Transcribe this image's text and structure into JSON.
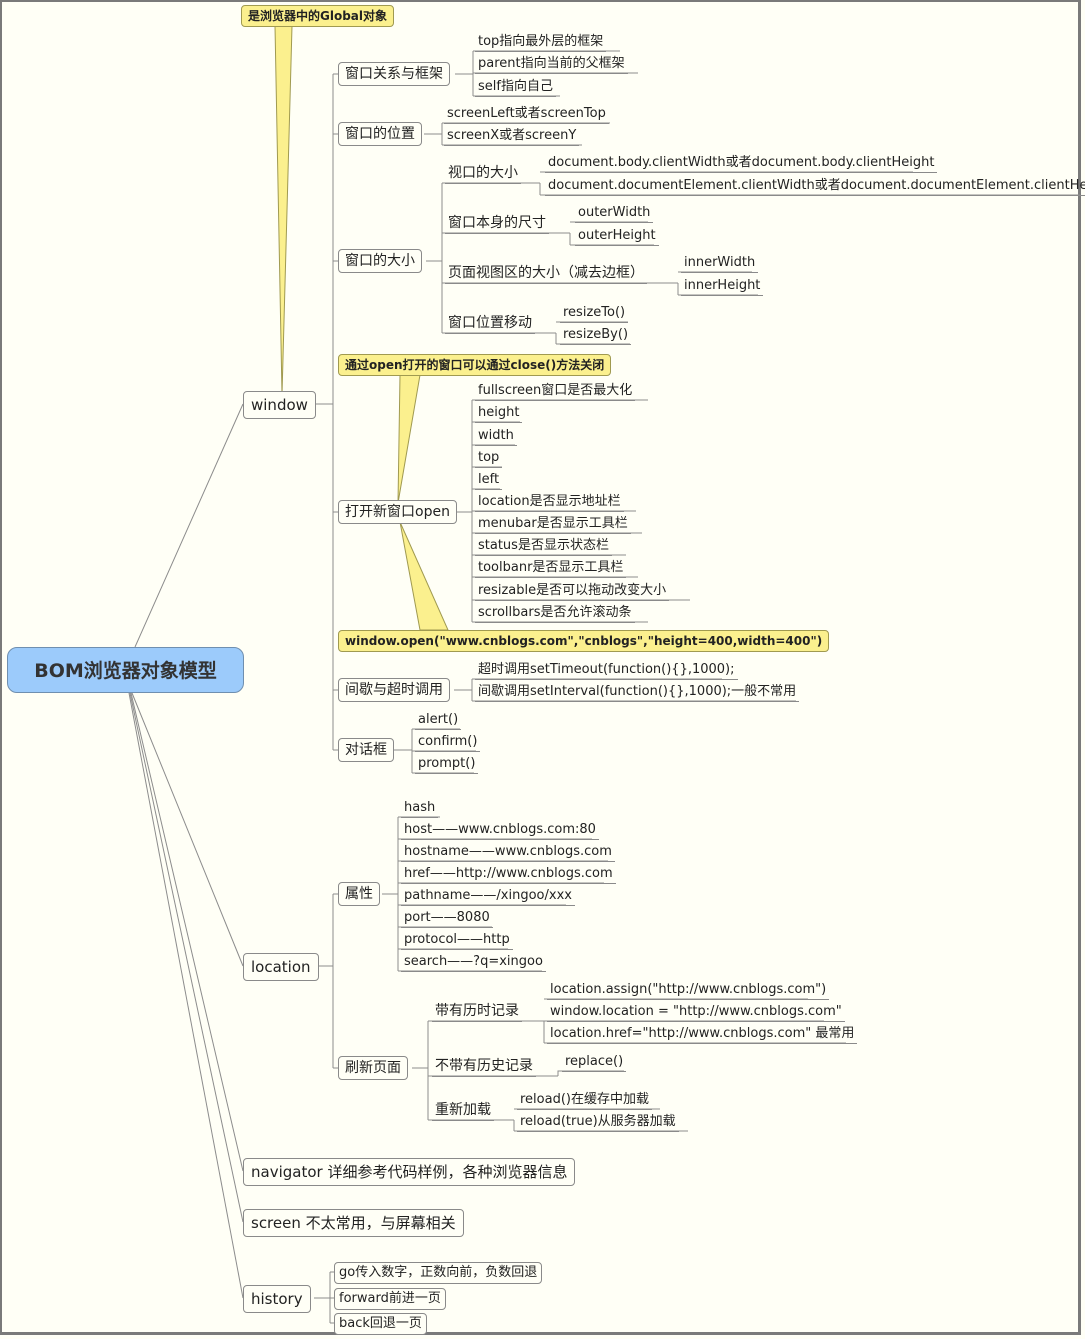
{
  "root": {
    "label": "BOM浏览器对象模型"
  },
  "window": {
    "label": "window",
    "note": "是浏览器中的Global对象",
    "children": [
      {
        "label": "窗口关系与框架",
        "items": [
          "top指向最外层的框架",
          "parent指向当前的父框架",
          "self指向自己"
        ]
      },
      {
        "label": "窗口的位置",
        "items": [
          "screenLeft或者screenTop",
          "screenX或者screenY"
        ]
      },
      {
        "label": "窗口的大小",
        "groups": [
          {
            "label": "视口的大小",
            "items": [
              "document.body.clientWidth或者document.body.clientHeight",
              "document.documentElement.clientWidth或者document.documentElement.clientHeight"
            ]
          },
          {
            "label": "窗口本身的尺寸",
            "items": [
              "outerWidth",
              "outerHeight"
            ]
          },
          {
            "label": "页面视图区的大小（减去边框）",
            "items": [
              "innerWidth",
              "innerHeight"
            ]
          },
          {
            "label": "窗口位置移动",
            "items": [
              "resizeTo()",
              "resizeBy()"
            ]
          }
        ]
      },
      {
        "label": "打开新窗口open",
        "note_top": "通过open打开的窗口可以通过close()方法关闭",
        "note_bottom": "window.open(\"www.cnblogs.com\",\"cnblogs\",\"height=400,width=400\")",
        "items": [
          "fullscreen窗口是否最大化",
          "height",
          "width",
          "top",
          "left",
          "location是否显示地址栏",
          "menubar是否显示工具栏",
          "status是否显示状态栏",
          "toolbanr是否显示工具栏",
          "resizable是否可以拖动改变大小",
          "scrollbars是否允许滚动条"
        ]
      },
      {
        "label": "间歇与超时调用",
        "items": [
          "超时调用setTimeout(function(){},1000);",
          "间歇调用setInterval(function(){},1000);一般不常用"
        ]
      },
      {
        "label": "对话框",
        "items": [
          "alert()",
          "confirm()",
          "prompt()"
        ]
      }
    ]
  },
  "location": {
    "label": "location",
    "children": [
      {
        "label": "属性",
        "items": [
          "hash",
          "host——www.cnblogs.com:80",
          "hostname——www.cnblogs.com",
          "href——http://www.cnblogs.com",
          "pathname——/xingoo/xxx",
          "port——8080",
          "protocol——http",
          "search——?q=xingoo"
        ]
      },
      {
        "label": "刷新页面",
        "groups": [
          {
            "label": "带有历时记录",
            "items": [
              "location.assign(\"http://www.cnblogs.com\")",
              "window.location = \"http://www.cnblogs.com\"",
              "location.href=\"http://www.cnblogs.com\"  最常用"
            ]
          },
          {
            "label": "不带有历史记录",
            "items": [
              "replace()"
            ]
          },
          {
            "label": "重新加载",
            "items": [
              "reload()在缓存中加载",
              "reload(true)从服务器加载"
            ]
          }
        ]
      }
    ]
  },
  "navigator": {
    "label": "navigator 详细参考代码样例，各种浏览器信息"
  },
  "screen": {
    "label": "screen 不太常用，与屏幕相关"
  },
  "history": {
    "label": "history",
    "items": [
      "go传入数字，正数向前，负数回退",
      "forward前进一页",
      "back回退一页"
    ]
  }
}
